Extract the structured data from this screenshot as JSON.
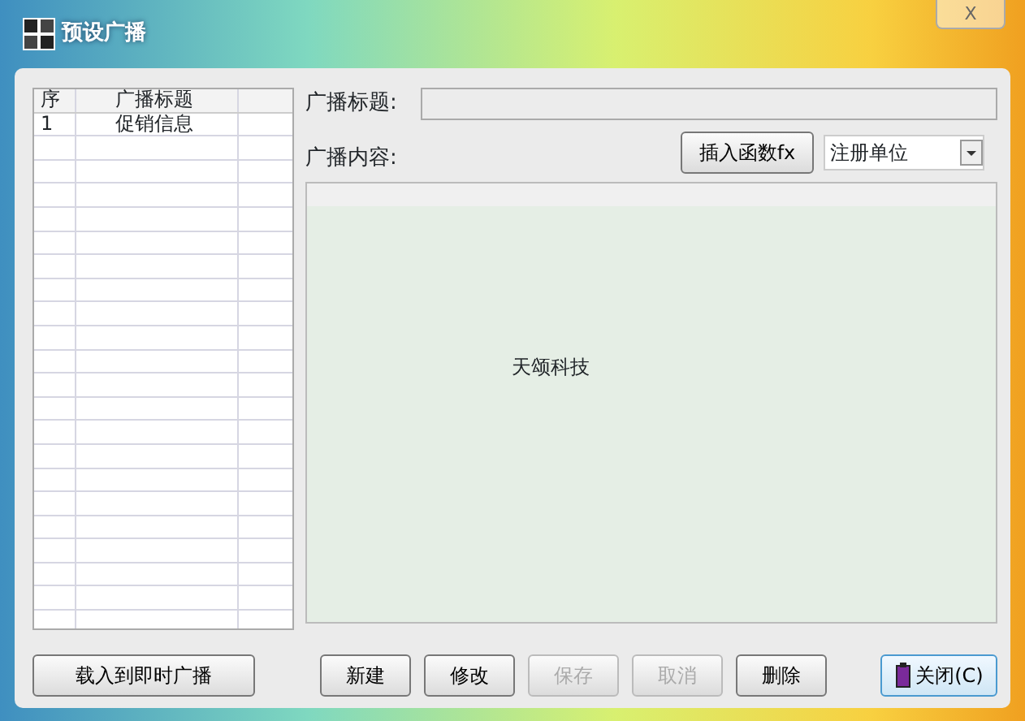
{
  "window": {
    "title": "预设广播",
    "close": "X"
  },
  "table": {
    "columns": [
      "序",
      "广播标题"
    ],
    "rows": [
      {
        "cells": [
          "1",
          "促销信息"
        ],
        "selected": false
      }
    ]
  },
  "title_field": {
    "label": "广播标题:"
  },
  "content_label": "广播内容:",
  "insert_button": "插入函数fx",
  "function_select": {
    "value": "注册单位"
  },
  "content_text": "天颂科技",
  "buttons": [
    {
      "label": "载入到即时广播",
      "disabled": false,
      "kind": "left"
    },
    {
      "label": "新建",
      "disabled": false,
      "kind": "action"
    },
    {
      "label": "修改",
      "disabled": false,
      "kind": "action"
    },
    {
      "label": "保存",
      "disabled": true,
      "kind": "action"
    },
    {
      "label": "取消",
      "disabled": true,
      "kind": "action"
    },
    {
      "label": "删除",
      "disabled": false,
      "kind": "action"
    },
    {
      "label": "关闭(C)",
      "disabled": false,
      "kind": "close"
    }
  ]
}
